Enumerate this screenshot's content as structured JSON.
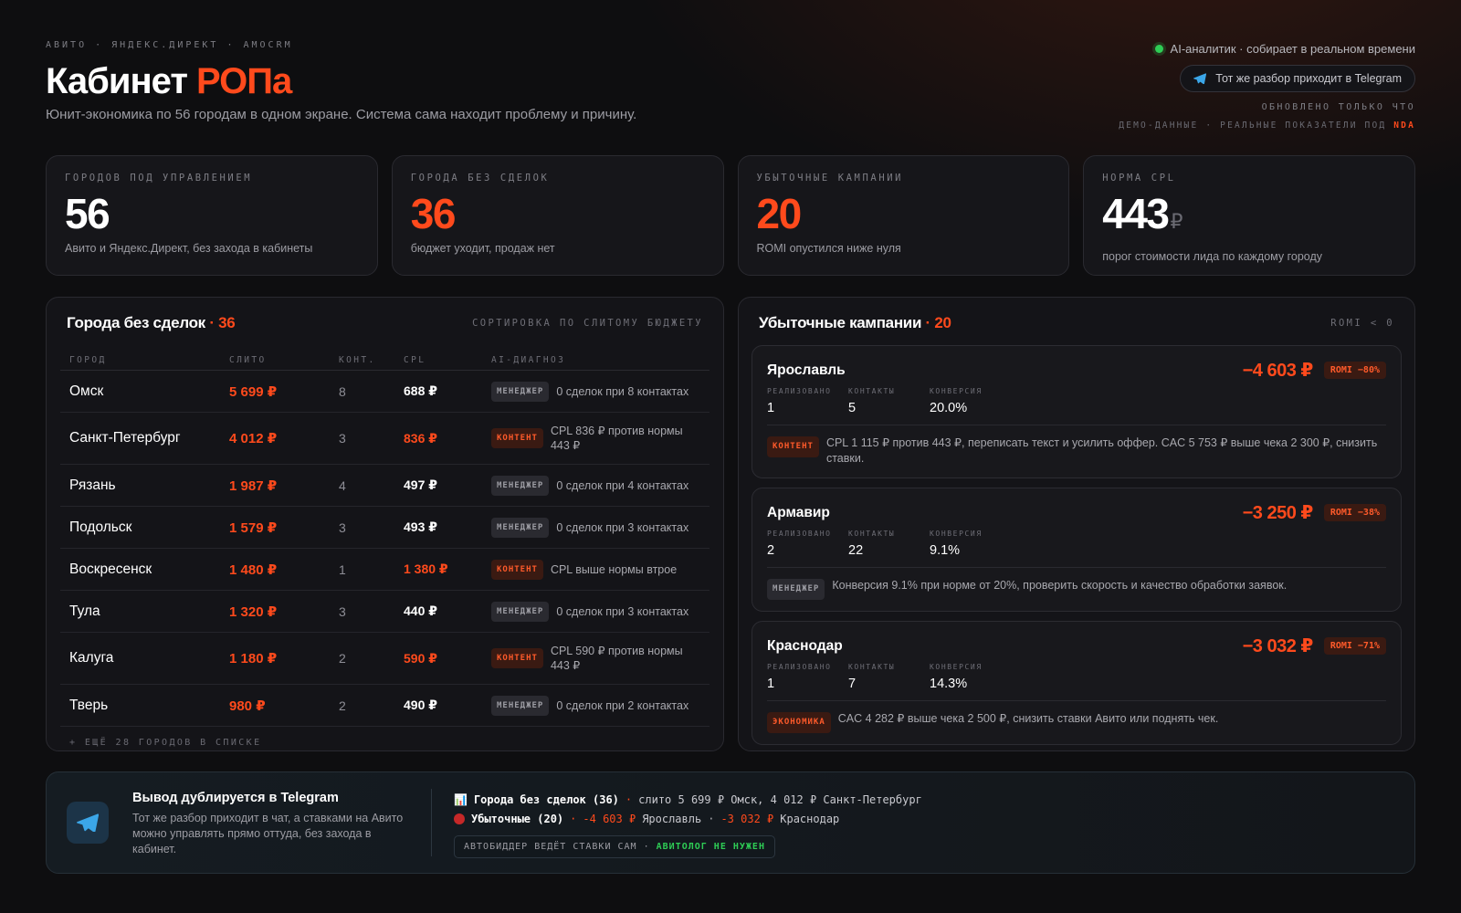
{
  "header": {
    "eyebrow": "АВИТО · ЯНДЕКС.ДИРЕКТ · AMOCRM",
    "title_main": "Кабинет ",
    "title_accent": "РОПа",
    "subtitle": "Юнит-экономика по 56 городам в одном экране. Система сама находит проблему и причину.",
    "live_status": "AI-аналитик · собирает в реальном времени",
    "telegram_pill": "Тот же разбор приходит в Telegram",
    "updated": "ОБНОВЛЕНО ТОЛЬКО ЧТО",
    "demo_note": "ДЕМО-ДАННЫЕ · РЕАЛЬНЫЕ ПОКАЗАТЕЛИ ПОД ",
    "demo_nda": "NDA"
  },
  "kpis": [
    {
      "label": "ГОРОДОВ ПОД УПРАВЛЕНИЕМ",
      "value": "56",
      "unit": "",
      "desc": "Авито и Яндекс.Директ, без захода в кабинеты",
      "accent": false
    },
    {
      "label": "ГОРОДА БЕЗ СДЕЛОК",
      "value": "36",
      "unit": "",
      "desc": "бюджет уходит, продаж нет",
      "accent": true
    },
    {
      "label": "УБЫТОЧНЫЕ КАМПАНИИ",
      "value": "20",
      "unit": "",
      "desc": "ROMI опустился ниже нуля",
      "accent": true
    },
    {
      "label": "НОРМА CPL",
      "value": "443",
      "unit": "₽",
      "desc": "порог стоимости лида по каждому городу",
      "accent": false
    }
  ],
  "no_deals": {
    "title": "Города без сделок",
    "count": " · 36",
    "sort_hint": "СОРТИРОВКА ПО СЛИТОМУ БЮДЖЕТУ",
    "columns": {
      "city": "ГОРОД",
      "spent": "СЛИТО",
      "contacts": "КОНТ.",
      "cpl": "CPL",
      "diagnosis": "AI-ДИАГНОЗ"
    },
    "rows": [
      {
        "city": "Омск",
        "spent": "5 699 ₽",
        "contacts": "8",
        "cpl": "688 ₽",
        "cpl_bad": false,
        "badge": "МЕНЕДЖЕР",
        "badge_type": "manager",
        "diagnosis": "0 сделок при 8 контактах"
      },
      {
        "city": "Санкт-Петербург",
        "spent": "4 012 ₽",
        "contacts": "3",
        "cpl": "836 ₽",
        "cpl_bad": true,
        "badge": "КОНТЕНТ",
        "badge_type": "content",
        "diagnosis": "CPL 836 ₽ против нормы 443 ₽"
      },
      {
        "city": "Рязань",
        "spent": "1 987 ₽",
        "contacts": "4",
        "cpl": "497 ₽",
        "cpl_bad": false,
        "badge": "МЕНЕДЖЕР",
        "badge_type": "manager",
        "diagnosis": "0 сделок при 4 контактах"
      },
      {
        "city": "Подольск",
        "spent": "1 579 ₽",
        "contacts": "3",
        "cpl": "493 ₽",
        "cpl_bad": false,
        "badge": "МЕНЕДЖЕР",
        "badge_type": "manager",
        "diagnosis": "0 сделок при 3 контактах"
      },
      {
        "city": "Воскресенск",
        "spent": "1 480 ₽",
        "contacts": "1",
        "cpl": "1 380 ₽",
        "cpl_bad": true,
        "badge": "КОНТЕНТ",
        "badge_type": "content",
        "diagnosis": "CPL выше нормы втрое"
      },
      {
        "city": "Тула",
        "spent": "1 320 ₽",
        "contacts": "3",
        "cpl": "440 ₽",
        "cpl_bad": false,
        "badge": "МЕНЕДЖЕР",
        "badge_type": "manager",
        "diagnosis": "0 сделок при 3 контактах"
      },
      {
        "city": "Калуга",
        "spent": "1 180 ₽",
        "contacts": "2",
        "cpl": "590 ₽",
        "cpl_bad": true,
        "badge": "КОНТЕНТ",
        "badge_type": "content",
        "diagnosis": "CPL 590 ₽ против нормы 443 ₽"
      },
      {
        "city": "Тверь",
        "spent": "980 ₽",
        "contacts": "2",
        "cpl": "490 ₽",
        "cpl_bad": false,
        "badge": "МЕНЕДЖЕР",
        "badge_type": "manager",
        "diagnosis": "0 сделок при 2 контактах"
      }
    ],
    "more": "+ ЕЩЁ 28 ГОРОДОВ В СПИСКЕ"
  },
  "losing": {
    "title": "Убыточные кампании",
    "count": " · 20",
    "hint": "ROMI < 0",
    "stat_labels": {
      "realized": "РЕАЛИЗОВАНО",
      "contacts": "КОНТАКТЫ",
      "conversion": "КОНВЕРСИЯ"
    },
    "items": [
      {
        "city": "Ярославль",
        "loss": "−4 603 ₽",
        "romi": "ROMI −80%",
        "realized": "1",
        "contacts": "5",
        "conversion": "20.0%",
        "badge": "КОНТЕНТ",
        "badge_type": "content",
        "note": "CPL 1 115 ₽ против 443 ₽, переписать текст и усилить оффер. CAC 5 753 ₽ выше чека 2 300 ₽, снизить ставки."
      },
      {
        "city": "Армавир",
        "loss": "−3 250 ₽",
        "romi": "ROMI −38%",
        "realized": "2",
        "contacts": "22",
        "conversion": "9.1%",
        "badge": "МЕНЕДЖЕР",
        "badge_type": "manager",
        "note": "Конверсия 9.1% при норме от 20%, проверить скорость и качество обработки заявок."
      },
      {
        "city": "Краснодар",
        "loss": "−3 032 ₽",
        "romi": "ROMI −71%",
        "realized": "1",
        "contacts": "7",
        "conversion": "14.3%",
        "badge": "ЭКОНОМИКА",
        "badge_type": "economy",
        "note": "CAC 4 282 ₽ выше чека 2 500 ₽, снизить ставки Авито или поднять чек."
      }
    ]
  },
  "footer": {
    "title": "Вывод дублируется в Telegram",
    "desc": "Тот же разбор приходит в чат, а ставками на Авито можно управлять прямо оттуда, без захода в кабинет.",
    "line1_icon": "📊",
    "line1_bold": "Города без сделок (36)",
    "line1_rest": "слито 5 699 ₽ Омск, 4 012 ₽ Санкт-Петербург",
    "line2_bold": "Убыточные (20)",
    "line2_v1": "-4 603 ₽",
    "line2_c1": "Ярославль",
    "line2_v2": "-3 032 ₽",
    "line2_c2": "Краснодар",
    "sep": "·",
    "pill_text": "АВТОБИДДЕР ВЕДЁТ СТАВКИ САМ · ",
    "pill_accent": "АВИТОЛОГ НЕ НУЖЕН"
  },
  "colors": {
    "accent": "#ff4a1c",
    "live": "#2ecc55",
    "telegram": "#3ba6e8",
    "background": "#0e0e10"
  },
  "icons": {
    "live": "live-dot-icon",
    "telegram": "telegram-icon",
    "chart": "chart-icon",
    "red_circle": "red-circle-icon"
  }
}
